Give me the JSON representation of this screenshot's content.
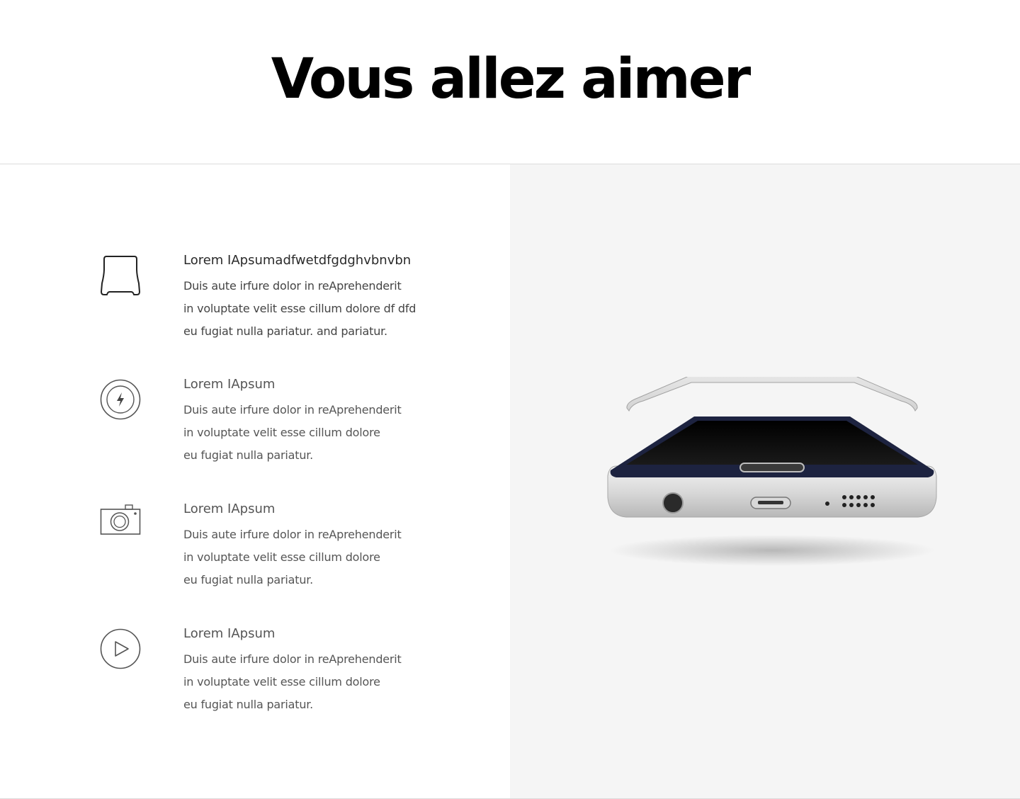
{
  "hero": {
    "title": "Vous allez aimer"
  },
  "features": [
    {
      "icon": "phone-case-icon",
      "title": "Lorem IApsumadfwetdfgdghvbnvbn",
      "lines": [
        "Duis aute irfure dolor in reAprehenderit",
        "in voluptate velit esse cillum dolore df dfd",
        "eu fugiat nulla pariatur. and pariatur."
      ]
    },
    {
      "icon": "charging-bolt-icon",
      "title": "Lorem IApsum",
      "lines": [
        "Duis aute irfure dolor in reAprehenderit",
        "in voluptate velit esse cillum dolore",
        "eu fugiat nulla pariatur."
      ]
    },
    {
      "icon": "camera-icon",
      "title": "Lorem IApsum",
      "lines": [
        "Duis aute irfure dolor in reAprehenderit",
        "in voluptate velit esse cillum dolore",
        "eu fugiat nulla pariatur."
      ]
    },
    {
      "icon": "play-icon",
      "title": "Lorem IApsum",
      "lines": [
        "Duis aute irfure dolor in reAprehenderit",
        "in voluptate velit esse cillum dolore",
        "eu fugiat nulla pariatur."
      ]
    }
  ],
  "product_image": {
    "subject": "phone-with-clear-case-image"
  },
  "colors": {
    "hero_text": "#000000",
    "text": "#555555",
    "right_panel_bg": "#f5f5f5",
    "divider": "#dcdcdc"
  }
}
